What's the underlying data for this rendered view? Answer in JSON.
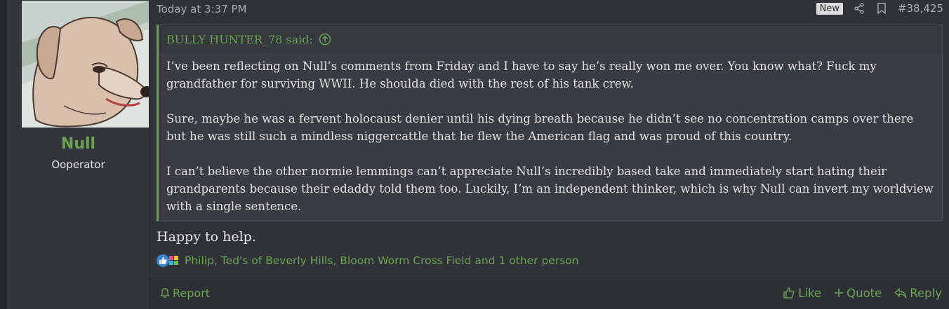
{
  "user": {
    "name": "Null",
    "title": "Ooperator",
    "avatar_icon": "dog-avatar"
  },
  "post": {
    "date": "Today at 3:37 PM",
    "new_badge": "New",
    "number": "#38,425",
    "quote": {
      "author": "BULLY HUNTER_78 said:",
      "paragraphs": [
        "I’ve been reflecting on Null’s comments from Friday and I have to say he’s really won me over. You know what? Fuck my grandfather for surviving WWII. He shoulda died with the rest of his tank crew.",
        "Sure, maybe he was a fervent holocaust denier until his dying breath because he didn’t see no concentration camps over there but he was still such a mindless niggercattle that he flew the American flag and was proud of this country.",
        "I can’t believe the other normie lemmings can’t appreciate Null’s incredibly based take and immediately start hating their grandparents because their edaddy told them too. Luckily, I’m an independent thinker, which is why Null can invert my worldview with a single sentence."
      ]
    },
    "body": "Happy to help.",
    "reactions": "Philip, Ted's of Beverly Hills, Bloom Worm Cross Field and 1 other person"
  },
  "footer": {
    "report": "Report",
    "like": "Like",
    "quote": "Quote",
    "reply": "Reply"
  },
  "colors": {
    "accent": "#6ba353",
    "background": "#2b2e33",
    "quote_bg": "#393c42",
    "like_blue": "#3a86d6"
  }
}
